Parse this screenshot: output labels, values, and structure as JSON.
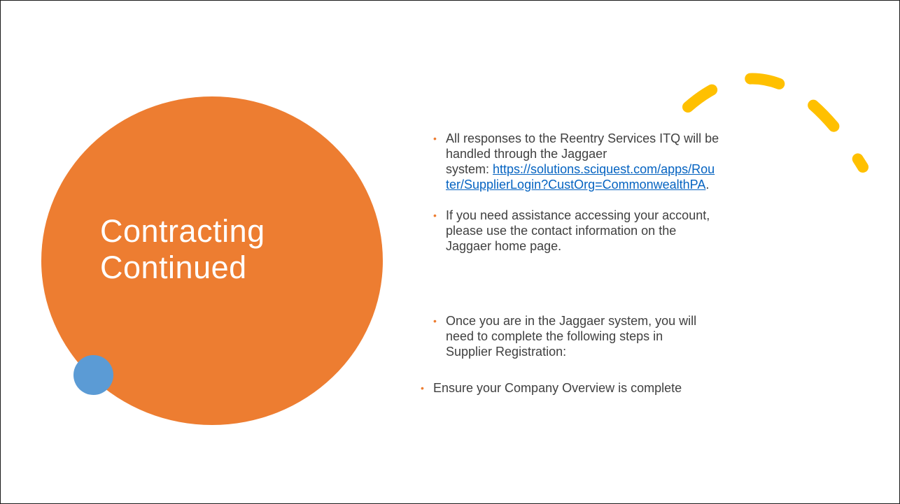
{
  "slide": {
    "title_line1": "Contracting",
    "title_line2": "Continued",
    "bullets": [
      {
        "text_before": "All responses to the Reentry Services ITQ will be\nhandled through the Jaggaer\nsystem: ",
        "link_line1": "https://solutions.sciquest.com/apps/Rou",
        "link_line2": "ter/SupplierLogin?CustOrg=CommonwealthPA",
        "text_after": "."
      },
      {
        "text": "If you need assistance accessing your account,\nplease use the contact information on the\nJaggaer home page."
      },
      {
        "text": "Once you are in the Jaggaer system, you will\nneed to complete the following steps in\nSupplier Registration:"
      },
      {
        "text": "Ensure your Company Overview is complete"
      }
    ],
    "bullet_glyph": "•"
  },
  "colors": {
    "accent_orange": "#ed7d31",
    "accent_blue": "#5b9bd5",
    "accent_yellow": "#ffc000",
    "link_blue": "#0563c1",
    "body_text": "#404040"
  }
}
